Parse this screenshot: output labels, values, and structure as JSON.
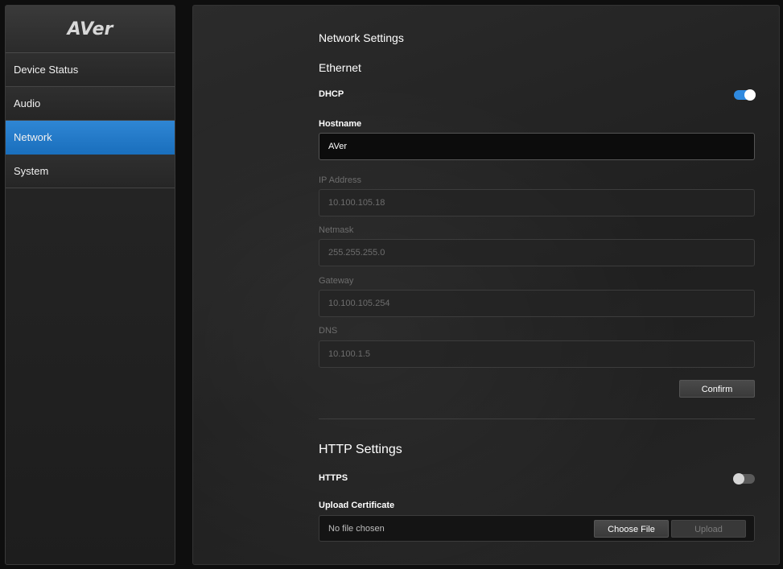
{
  "brand": {
    "logo_text": "AVer"
  },
  "sidebar": {
    "items": [
      {
        "label": "Device Status",
        "active": false
      },
      {
        "label": "Audio",
        "active": false
      },
      {
        "label": "Network",
        "active": true
      },
      {
        "label": "System",
        "active": false
      }
    ]
  },
  "network": {
    "title": "Network Settings",
    "ethernet": {
      "title": "Ethernet",
      "dhcp_label": "DHCP",
      "dhcp_enabled": true,
      "hostname_label": "Hostname",
      "hostname_value": "AVer",
      "ip_label": "IP Address",
      "ip_value": "10.100.105.18",
      "netmask_label": "Netmask",
      "netmask_value": "255.255.255.0",
      "gateway_label": "Gateway",
      "gateway_value": "10.100.105.254",
      "dns_label": "DNS",
      "dns_value": "10.100.1.5",
      "confirm_label": "Confirm"
    }
  },
  "http": {
    "title": "HTTP Settings",
    "https_label": "HTTPS",
    "https_enabled": false,
    "upload_label": "Upload Certificate",
    "file_status": "No file chosen",
    "choose_file_label": "Choose File",
    "upload_button_label": "Upload"
  },
  "colors": {
    "accent": "#1f78c8",
    "toggle_on": "#2f8ae0"
  }
}
